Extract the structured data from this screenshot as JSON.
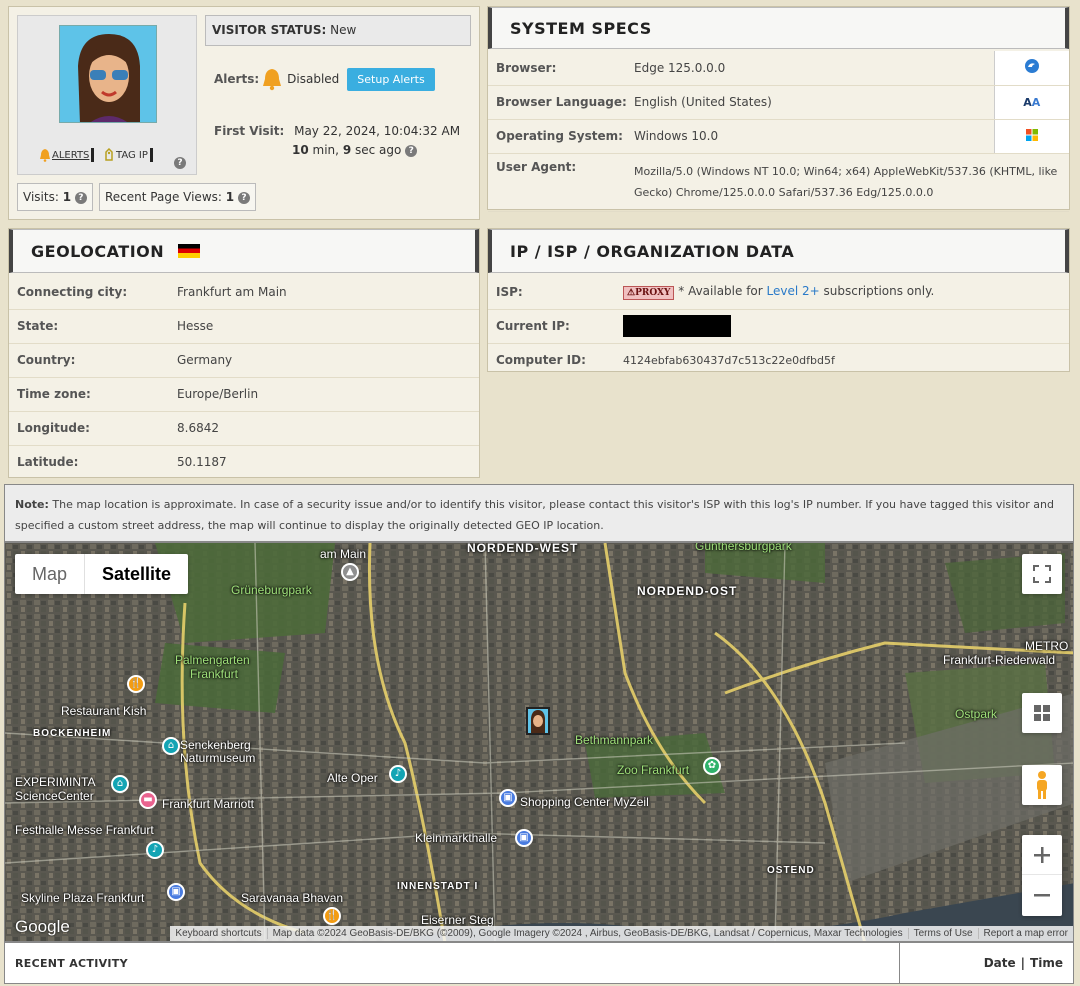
{
  "visitor": {
    "status_label": "VISITOR STATUS:",
    "status_value": "New",
    "alerts_label": "Alerts:",
    "alerts_value": "Disabled",
    "setup_alerts": "Setup Alerts",
    "first_visit_label": "First Visit:",
    "first_visit_date": "May 22, 2024, 10:04:32 AM",
    "duration_min": "10",
    "duration_min_unit": "min,",
    "duration_sec": "9",
    "duration_sec_unit": "sec ago",
    "alerts_button": "ALERTS",
    "tag_ip_button": "TAG IP",
    "visits_label": "Visits:",
    "visits_value": "1",
    "page_views_label": "Recent Page Views:",
    "page_views_value": "1"
  },
  "system_specs": {
    "title": "SYSTEM SPECS",
    "rows": [
      {
        "label": "Browser:",
        "value": "Edge 125.0.0.0",
        "icon": "edge-browser-icon"
      },
      {
        "label": "Browser Language:",
        "value": "English (United States)",
        "icon": "language-icon"
      },
      {
        "label": "Operating System:",
        "value": "Windows 10.0",
        "icon": "windows-icon"
      },
      {
        "label": "User Agent:",
        "value": "Mozilla/5.0 (Windows NT 10.0; Win64; x64) AppleWebKit/537.36 (KHTML, like Gecko) Chrome/125.0.0.0 Safari/537.36 Edg/125.0.0.0"
      }
    ]
  },
  "geolocation": {
    "title": "GEOLOCATION",
    "flag": "germany-flag-icon",
    "rows": [
      {
        "label": "Connecting city:",
        "value": "Frankfurt am Main"
      },
      {
        "label": "State:",
        "value": "Hesse"
      },
      {
        "label": "Country:",
        "value": "Germany"
      },
      {
        "label": "Time zone:",
        "value": "Europe/Berlin"
      },
      {
        "label": "Longitude:",
        "value": "8.6842"
      },
      {
        "label": "Latitude:",
        "value": "50.1187"
      }
    ]
  },
  "isp": {
    "title": "IP / ISP / ORGANIZATION DATA",
    "isp_label": "ISP:",
    "proxy_badge": "PROXY",
    "isp_note_prefix": "* Available for",
    "isp_note_link": "Level 2+",
    "isp_note_suffix": "subscriptions only.",
    "current_ip_label": "Current IP:",
    "computer_id_label": "Computer ID:",
    "computer_id_value": "4124ebfab630437d7c513c22e0dfbd5f"
  },
  "note": {
    "label": "Note:",
    "text": "The map location is approximate. In case of a security issue and/or to identify this visitor, please contact this visitor's ISP with this log's IP number. If you have tagged this visitor and specified a custom street address, the map will continue to display the originally detected GEO IP location."
  },
  "map": {
    "tab_map": "Map",
    "tab_satellite": "Satellite",
    "labels": {
      "nordend_west": "NORDEND-WEST",
      "nordend_ost": "NORDEND-OST",
      "gruneburgpark": "Grüneburgpark",
      "palmengarten": "Palmengarten",
      "palmengarten2": "Frankfurt",
      "restaurant_kish": "Restaurant Kish",
      "bockenheim": "BOCKENHEIM",
      "senckenberg": "Senckenberg",
      "senckenberg2": "Naturmuseum",
      "experiminta": "EXPERIMINTA",
      "sciencecenter": "ScienceCenter",
      "frankfurt_marriott": "Frankfurt Marriott",
      "festhalle": "Festhalle Messe Frankfurt",
      "skyline_plaza": "Skyline Plaza Frankfurt",
      "saravanaa": "Saravanaa Bhavan",
      "alte_oper": "Alte Oper",
      "kleinmarkthalle": "Kleinmarkthalle",
      "innenstadt": "INNENSTADT I",
      "eiserner_steg": "Eiserner Steg",
      "shopping_center": "Shopping Center MyZeil",
      "zoo": "Zoo Frankfurt",
      "bethmannpark": "Bethmannpark",
      "ostend": "OSTEND",
      "ostpark": "Ostpark",
      "frankfurt_riederwald": "Frankfurt-Riederwald",
      "metro": "METRO",
      "gunthersburgpark": "Günthersburgpark",
      "am_main": "am Main"
    },
    "google": "Google",
    "keyboard_shortcuts": "Keyboard shortcuts",
    "map_data": "Map data ©2024 GeoBasis-DE/BKG (©2009), Google Imagery ©2024 , Airbus, GeoBasis-DE/BKG, Landsat / Copernicus, Maxar Technologies",
    "terms": "Terms of Use",
    "report": "Report a map error"
  },
  "recent_activity": {
    "title": "RECENT ACTIVITY",
    "date_label": "Date",
    "separator": "|",
    "time_label": "Time"
  }
}
